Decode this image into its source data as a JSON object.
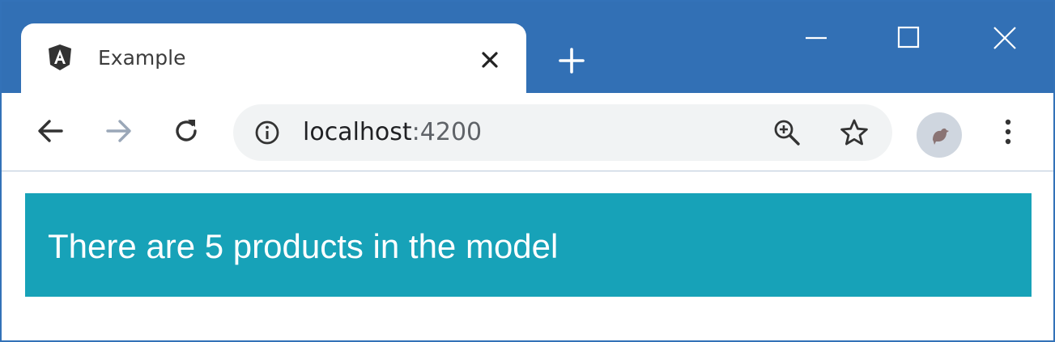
{
  "window": {
    "title_bar_color": "#3270b5"
  },
  "tab": {
    "title": "Example",
    "favicon": "angular-icon"
  },
  "toolbar": {
    "url_host": "localhost",
    "url_port": ":4200"
  },
  "page": {
    "message": "There are 5 products in the model",
    "alert_color": "#17a2b8"
  },
  "icons": {
    "new_tab": "plus-icon",
    "minimize": "minimize-icon",
    "maximize": "maximize-icon",
    "close": "close-icon",
    "back": "back-arrow-icon",
    "forward": "forward-arrow-icon",
    "reload": "reload-icon",
    "site_info": "info-icon",
    "zoom": "zoom-in-icon",
    "bookmark": "star-icon",
    "profile": "bird-avatar-icon",
    "menu": "kebab-menu-icon"
  }
}
